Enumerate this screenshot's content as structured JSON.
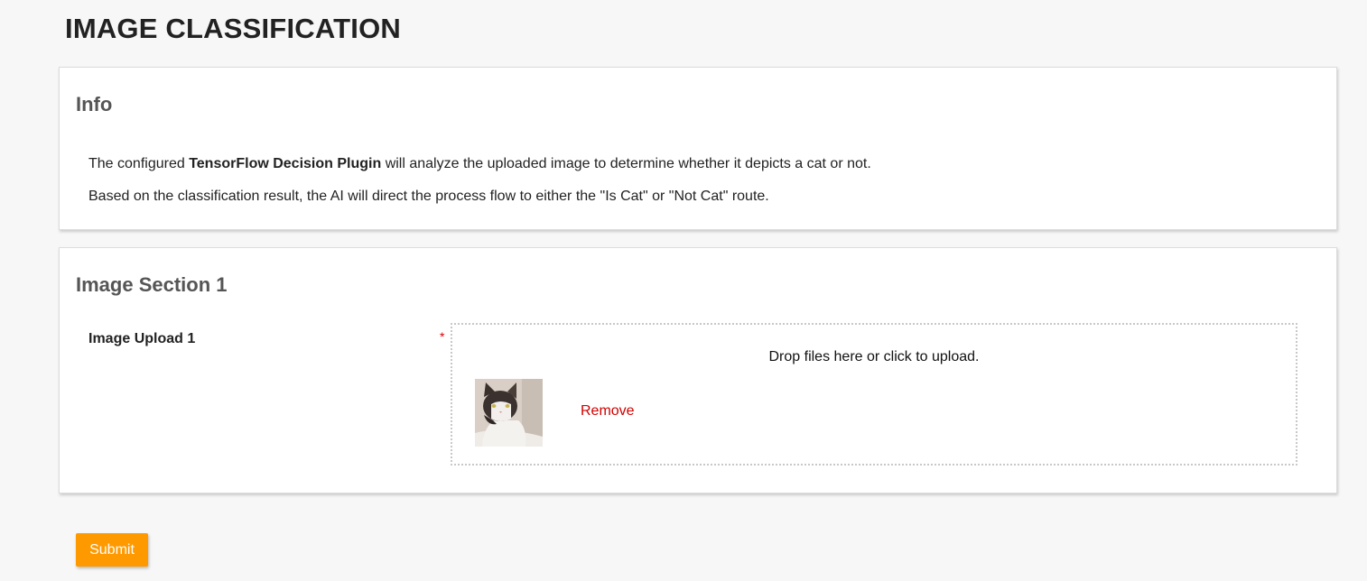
{
  "page": {
    "title": "IMAGE CLASSIFICATION"
  },
  "info": {
    "heading": "Info",
    "line1_prefix": "The configured ",
    "line1_bold": "TensorFlow Decision Plugin",
    "line1_suffix": " will analyze the uploaded image to determine whether it depicts a cat or not.",
    "line2": "Based on the classification result, the AI will direct the process flow to either the \"Is Cat\" or \"Not Cat\" route."
  },
  "image_section": {
    "heading": "Image Section 1",
    "field_label": "Image Upload 1",
    "required_mark": "*",
    "dropzone_text": "Drop files here or click to upload.",
    "remove_label": "Remove",
    "uploaded_files": [
      {
        "thumbnail": "cat-photo-thumbnail"
      }
    ]
  },
  "actions": {
    "submit_label": "Submit"
  },
  "colors": {
    "accent": "#ff9900",
    "remove": "#d00000",
    "required": "#dd0000",
    "heading": "#555555"
  }
}
